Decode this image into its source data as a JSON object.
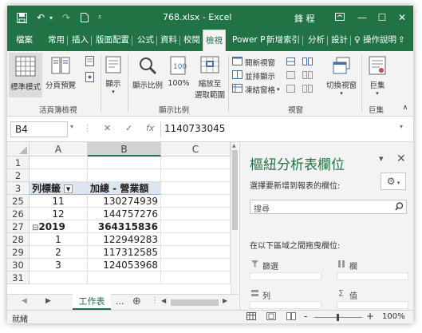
{
  "window": {
    "file_name": "768.xlsx",
    "separator": "-",
    "app_name": "Excel",
    "user_name": "鋒 程",
    "colors": {
      "accent": "#217346",
      "header_fill": "#dce6f1"
    }
  },
  "qat": {
    "save_icon": "save-icon",
    "undo_icon": "undo-icon",
    "redo_icon": "redo-icon",
    "new_icon": "new-file-icon",
    "customize_icon": "chevron-down-icon"
  },
  "tabs": [
    {
      "label": "檔案"
    },
    {
      "label": "常用"
    },
    {
      "label": "插入"
    },
    {
      "label": "版面配置"
    },
    {
      "label": "公式"
    },
    {
      "label": "資料"
    },
    {
      "label": "校閱"
    },
    {
      "label": "檢視"
    },
    {
      "label": "Power P"
    },
    {
      "label": "新增索引"
    },
    {
      "label": "分析"
    },
    {
      "label": "設計"
    },
    {
      "label": "♀ 操作說明"
    }
  ],
  "ribbon": {
    "normal_view": "標準模式",
    "page_break_preview": "分頁預覽",
    "show": "顯示",
    "zoom": "顯示比例",
    "zoom_100": "100%",
    "zoom_to_selection_1": "縮放至",
    "zoom_to_selection_2": "選取範圍",
    "new_window": "開新視窗",
    "arrange_all": "並排顯示",
    "freeze_panes": "凍結窗格",
    "switch_windows": "切換視窗",
    "macros": "巨集",
    "group_workbook_views": "活頁簿檢視",
    "group_zoom": "顯示比例",
    "group_window": "視窗",
    "group_macros": "巨集"
  },
  "formula_bar": {
    "name_box": "B4",
    "cancel": "✕",
    "enter": "✓",
    "fx": "fx",
    "content": "1140733045"
  },
  "grid": {
    "columns": [
      "A",
      "B",
      "C"
    ],
    "rows": [
      {
        "num": "1",
        "a": "",
        "b": ""
      },
      {
        "num": "2",
        "a": "",
        "b": ""
      },
      {
        "num": "3",
        "a": "列標籤",
        "b": "加總 - 營業額",
        "header": true
      },
      {
        "num": "25",
        "a": "11",
        "b": "130274939"
      },
      {
        "num": "26",
        "a": "12",
        "b": "144757276"
      },
      {
        "num": "27",
        "a": "2019",
        "b": "364315836",
        "bold": true,
        "collapse": "⊟"
      },
      {
        "num": "28",
        "a": "1",
        "b": "122949283"
      },
      {
        "num": "29",
        "a": "2",
        "b": "117312585"
      },
      {
        "num": "30",
        "a": "3",
        "b": "124053968"
      },
      {
        "num": "31",
        "a": "",
        "b": ""
      }
    ]
  },
  "sheets": {
    "active": "工作表",
    "more": "...",
    "add": "⊕"
  },
  "pivot_pane": {
    "title": "樞紐分析表欄位",
    "choose_fields": "選擇要新增到報表的欄位:",
    "search_placeholder": "搜尋",
    "drag_fields": "在以下區域之間拖曳欄位:",
    "filters": "篩選",
    "columns": "欄",
    "rows": "列",
    "values": "值"
  },
  "status_bar": {
    "ready": "就緒",
    "zoom_minus": "-",
    "zoom_plus": "+",
    "zoom_level": "100%"
  }
}
